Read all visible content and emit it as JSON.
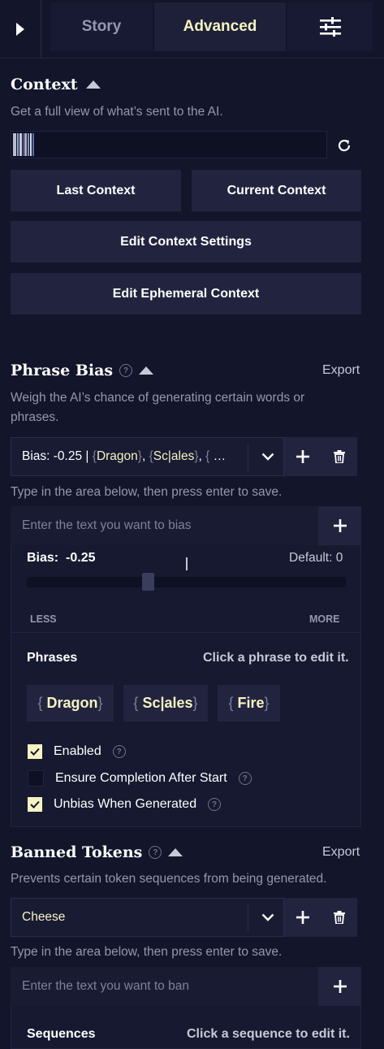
{
  "tabs": {
    "story": "Story",
    "advanced": "Advanced",
    "settings_icon": "sliders-icon"
  },
  "context": {
    "title": "Context",
    "description": "Get a full view of what’s sent to the AI.",
    "last_context": "Last Context",
    "current_context": "Current Context",
    "edit_settings": "Edit Context Settings",
    "edit_ephemeral": "Edit Ephemeral Context"
  },
  "phrase_bias": {
    "title": "Phrase Bias",
    "export": "Export",
    "description_line1": "Weigh the AI’s chance of generating certain words or",
    "description_line2": "phrases.",
    "select": {
      "prefix": "Bias: -0.25 |",
      "items": [
        "Dragon",
        "Sc|ales"
      ],
      "ellipsis": "…"
    },
    "instruction": "Type in the area below, then press enter to save.",
    "input_placeholder": "Enter the text you want to bias",
    "bias_label": "Bias:",
    "bias_value": "-0.25",
    "default_label": "Default: 0",
    "less": "LESS",
    "more": "MORE",
    "slider_fraction": 0.375,
    "phrases_label": "Phrases",
    "phrases_hint": "Click a phrase to edit it.",
    "phrases": [
      "Dragon",
      "Sc|ales",
      "Fire"
    ],
    "options": [
      {
        "label": "Enabled",
        "checked": true
      },
      {
        "label": "Ensure Completion After Start",
        "checked": false
      },
      {
        "label": "Unbias When Generated",
        "checked": true
      }
    ]
  },
  "banned_tokens": {
    "title": "Banned Tokens",
    "export": "Export",
    "description": "Prevents certain token sequences from being generated.",
    "select_value": "Cheese",
    "instruction": "Type in the area below, then press enter to save.",
    "input_placeholder": "Enter the text you want to ban",
    "sequences_label": "Sequences",
    "sequences_hint": "Click a sequence to edit it."
  },
  "colors": {
    "background": "#13152b",
    "button": "#22243f",
    "accent": "#f5f3c2",
    "muted": "#9497ad"
  }
}
